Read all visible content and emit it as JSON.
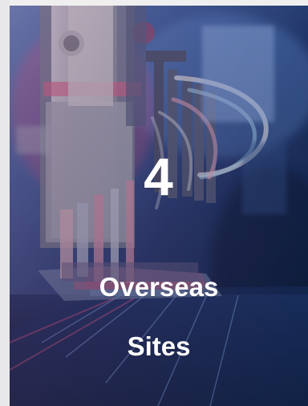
{
  "card": {
    "number": "4",
    "label_line_1": "Overseas",
    "label_line_2": "Sites"
  },
  "colors": {
    "page_background": "#f1f1f2",
    "card_dark": "#0b1732",
    "text": "#ffffff",
    "blue_light": "#4b8fdc",
    "magenta_light": "#e24b7f",
    "steel": "#9aa7b8"
  },
  "icons": {
    "background": "industrial-machinery-photo-icon"
  }
}
